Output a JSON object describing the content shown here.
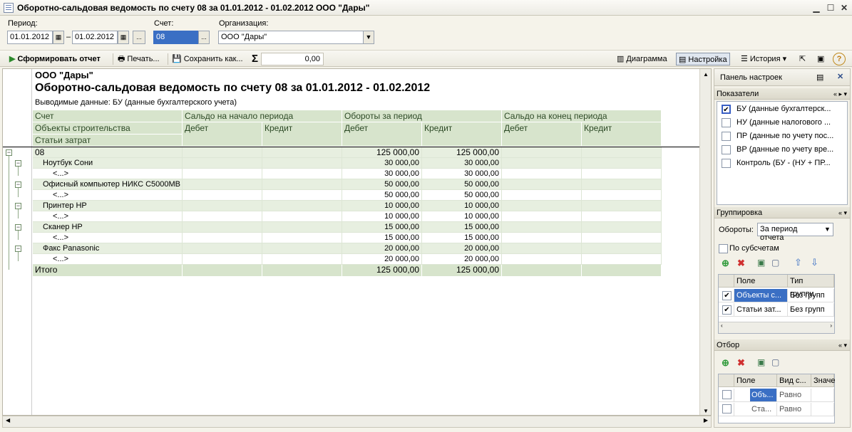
{
  "window": {
    "title": "Оборотно-сальдовая ведомость по счету 08 за 01.01.2012 - 01.02.2012 ООО \"Дары\""
  },
  "params": {
    "period_label": "Период:",
    "period_from": "01.01.2012",
    "period_dash": "–",
    "period_to": "01.02.2012",
    "more": "...",
    "account_label": "Счет:",
    "account_value": "08",
    "org_label": "Организация:",
    "org_value": "ООО \"Дары\""
  },
  "toolbar": {
    "generate": "Сформировать отчет",
    "print": "Печать...",
    "save": "Сохранить как...",
    "sum_symbol": "Σ",
    "sum_value": "0,00",
    "diagram": "Диаграмма",
    "settings": "Настройка",
    "history": "История"
  },
  "report": {
    "org": "ООО \"Дары\"",
    "title": "Оборотно-сальдовая ведомость по счету 08 за 01.01.2012 - 01.02.2012",
    "output_data": "Выводимые данные:  БУ (данные бухгалтерского учета)",
    "headers": {
      "account": "Счет",
      "objects": "Объекты строительства",
      "costs": "Статьи затрат",
      "start_balance": "Сальдо на начало периода",
      "turnover": "Обороты за период",
      "end_balance": "Сальдо на конец периода",
      "debit": "Дебет",
      "credit": "Кредит"
    },
    "rows": [
      {
        "label": "08",
        "d1": "",
        "c1": "",
        "d2": "125 000,00",
        "c2": "125 000,00",
        "d3": "",
        "c3": ""
      },
      {
        "label": "Ноутбук Сони",
        "d1": "",
        "c1": "",
        "d2": "30 000,00",
        "c2": "30 000,00",
        "d3": "",
        "c3": ""
      },
      {
        "label": "<...>",
        "d1": "",
        "c1": "",
        "d2": "30 000,00",
        "c2": "30 000,00",
        "d3": "",
        "c3": ""
      },
      {
        "label": "Офисный компьютер НИКС C5000MB",
        "d1": "",
        "c1": "",
        "d2": "50 000,00",
        "c2": "50 000,00",
        "d3": "",
        "c3": ""
      },
      {
        "label": "<...>",
        "d1": "",
        "c1": "",
        "d2": "50 000,00",
        "c2": "50 000,00",
        "d3": "",
        "c3": ""
      },
      {
        "label": "Принтер HP",
        "d1": "",
        "c1": "",
        "d2": "10 000,00",
        "c2": "10 000,00",
        "d3": "",
        "c3": ""
      },
      {
        "label": "<...>",
        "d1": "",
        "c1": "",
        "d2": "10 000,00",
        "c2": "10 000,00",
        "d3": "",
        "c3": ""
      },
      {
        "label": "Сканер HP",
        "d1": "",
        "c1": "",
        "d2": "15 000,00",
        "c2": "15 000,00",
        "d3": "",
        "c3": ""
      },
      {
        "label": "<...>",
        "d1": "",
        "c1": "",
        "d2": "15 000,00",
        "c2": "15 000,00",
        "d3": "",
        "c3": ""
      },
      {
        "label": "Факс Panasonic",
        "d1": "",
        "c1": "",
        "d2": "20 000,00",
        "c2": "20 000,00",
        "d3": "",
        "c3": ""
      },
      {
        "label": "<...>",
        "d1": "",
        "c1": "",
        "d2": "20 000,00",
        "c2": "20 000,00",
        "d3": "",
        "c3": ""
      }
    ],
    "total": {
      "label": "Итого",
      "d2": "125 000,00",
      "c2": "125 000,00"
    }
  },
  "panel": {
    "title": "Панель настроек",
    "indicators_title": "Показатели",
    "indicators": [
      {
        "label": "БУ (данные бухгалтерск...",
        "checked": true
      },
      {
        "label": "НУ (данные налогового ...",
        "checked": false
      },
      {
        "label": "ПР (данные по учету пос...",
        "checked": false
      },
      {
        "label": "ВР (данные по учету вре...",
        "checked": false
      },
      {
        "label": "Контроль (БУ - (НУ + ПР...",
        "checked": false
      }
    ],
    "grouping_title": "Группировка",
    "turnover_label": "Обороты:",
    "turnover_value": "За период отчета",
    "subaccounts": "По субсчетам",
    "group_cols": [
      "Поле",
      "Тип группи..."
    ],
    "group_rows": [
      {
        "field": "Объекты с...",
        "type": "Без групп"
      },
      {
        "field": "Статьи зат...",
        "type": "Без групп"
      }
    ],
    "filter_title": "Отбор",
    "filter_cols": [
      "Поле",
      "Вид с...",
      "Значе"
    ],
    "filter_rows": [
      {
        "field": "Объ...",
        "kind": "Равно"
      },
      {
        "field": "Ста...",
        "kind": "Равно"
      }
    ]
  }
}
